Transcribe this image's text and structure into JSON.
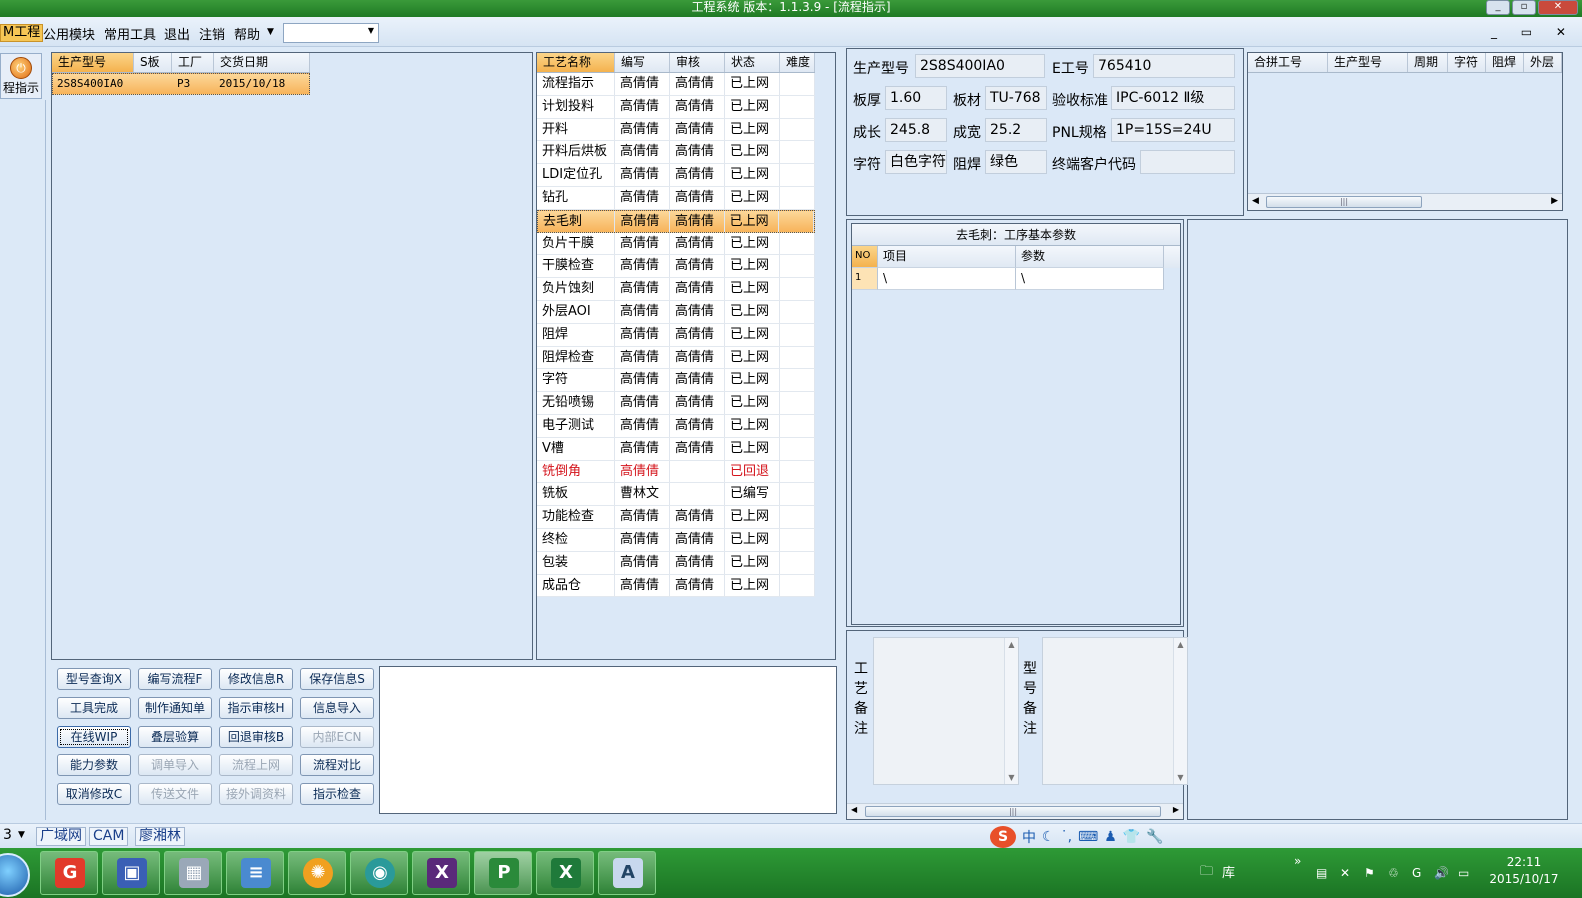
{
  "window": {
    "title": "工程系统   版本：1.1.3.9 - [流程指示]",
    "controls": [
      "_",
      "▫",
      "✕"
    ]
  },
  "menubar": {
    "items": [
      "M工程",
      "公用模块",
      "常用工具",
      "退出",
      "注销",
      "帮助"
    ],
    "mdi_controls": "_ ▭ ✕"
  },
  "leftnav": {
    "label": "程指示"
  },
  "model_grid": {
    "headers": [
      "生产型号",
      "S板",
      "工厂",
      "交货日期"
    ],
    "rows": [
      [
        "2S8S400IA0",
        "",
        "P3",
        "2015/10/18"
      ]
    ]
  },
  "process_grid": {
    "headers": [
      "工艺名称",
      "编写",
      "审核",
      "状态",
      "难度"
    ],
    "rows": [
      [
        "流程指示",
        "高倩倩",
        "高倩倩",
        "已上网",
        ""
      ],
      [
        "计划投料",
        "高倩倩",
        "高倩倩",
        "已上网",
        ""
      ],
      [
        "开料",
        "高倩倩",
        "高倩倩",
        "已上网",
        ""
      ],
      [
        "开料后烘板",
        "高倩倩",
        "高倩倩",
        "已上网",
        ""
      ],
      [
        "LDI定位孔",
        "高倩倩",
        "高倩倩",
        "已上网",
        ""
      ],
      [
        "钻孔",
        "高倩倩",
        "高倩倩",
        "已上网",
        ""
      ],
      [
        "去毛刺",
        "高倩倩",
        "高倩倩",
        "已上网",
        ""
      ],
      [
        "负片干膜",
        "高倩倩",
        "高倩倩",
        "已上网",
        ""
      ],
      [
        "干膜检查",
        "高倩倩",
        "高倩倩",
        "已上网",
        ""
      ],
      [
        "负片蚀刻",
        "高倩倩",
        "高倩倩",
        "已上网",
        ""
      ],
      [
        "外层AOI",
        "高倩倩",
        "高倩倩",
        "已上网",
        ""
      ],
      [
        "阻焊",
        "高倩倩",
        "高倩倩",
        "已上网",
        ""
      ],
      [
        "阻焊检查",
        "高倩倩",
        "高倩倩",
        "已上网",
        ""
      ],
      [
        "字符",
        "高倩倩",
        "高倩倩",
        "已上网",
        ""
      ],
      [
        "无铅喷锡",
        "高倩倩",
        "高倩倩",
        "已上网",
        ""
      ],
      [
        "电子测试",
        "高倩倩",
        "高倩倩",
        "已上网",
        ""
      ],
      [
        "V槽",
        "高倩倩",
        "高倩倩",
        "已上网",
        ""
      ],
      [
        "铣倒角",
        "高倩倩",
        "",
        "已回退",
        ""
      ],
      [
        "铣板",
        "曹林文",
        "",
        "已编写",
        ""
      ],
      [
        "功能检查",
        "高倩倩",
        "高倩倩",
        "已上网",
        ""
      ],
      [
        "终检",
        "高倩倩",
        "高倩倩",
        "已上网",
        ""
      ],
      [
        "包装",
        "高倩倩",
        "高倩倩",
        "已上网",
        ""
      ],
      [
        "成品仓",
        "高倩倩",
        "高倩倩",
        "已上网",
        ""
      ]
    ],
    "selected_index": 6,
    "red_index": 17
  },
  "buttons": [
    [
      "型号查询X",
      "编写流程F",
      "修改信息R",
      "保存信息S"
    ],
    [
      "工具完成",
      "制作通知单",
      "指示审核H",
      "信息导入"
    ],
    [
      "在线WIP",
      "叠层验算",
      "回退审核B",
      "内部ECN"
    ],
    [
      "能力参数",
      "调单导入",
      "流程上网",
      "流程对比"
    ],
    [
      "取消修改C",
      "传送文件",
      "接外调资料",
      "指示检查"
    ]
  ],
  "disabled_buttons": [
    "内部ECN",
    "调单导入",
    "流程上网",
    "传送文件",
    "接外调资料"
  ],
  "info": {
    "prod_model_label": "生产型号",
    "prod_model": "2S8S400IA0",
    "e_no_label": "E工号",
    "e_no": "765410",
    "thickness_label": "板厚",
    "thickness": "1.60",
    "material_label": "板材",
    "material": "TU-768",
    "standard_label": "验收标准",
    "standard": "IPC-6012 Ⅱ级",
    "length_label": "成长",
    "length": "245.8",
    "width_label": "成宽",
    "width": "25.2",
    "pnl_label": "PNL规格",
    "pnl": "1P=15S=24U",
    "char_label": "字符",
    "char": "白色字符",
    "mask_label": "阻焊",
    "mask": "绿色",
    "customer_label": "终端客户代码",
    "customer": ""
  },
  "merge_grid": {
    "headers": [
      "合拼工号",
      "生产型号",
      "周期",
      "字符",
      "阻焊",
      "外层"
    ]
  },
  "params": {
    "title": "去毛刺：工序基本参数",
    "headers": [
      "NO",
      "项目",
      "参数"
    ],
    "rows": [
      [
        "1",
        "\\",
        "\\"
      ]
    ]
  },
  "notes": {
    "process_note_label": "工艺备注",
    "model_note_label": "型号备注"
  },
  "statusbar": {
    "segments": [
      "3",
      "广域网",
      "CAM",
      "廖湘林"
    ],
    "ime": "中"
  },
  "taskbar": {
    "tray_label": "库",
    "time": "22:11",
    "date": "2015/10/17"
  },
  "colors": {
    "selection": "#f7b35a",
    "reverted_text": "#d4141c",
    "taskbar": "#1f7a24"
  }
}
